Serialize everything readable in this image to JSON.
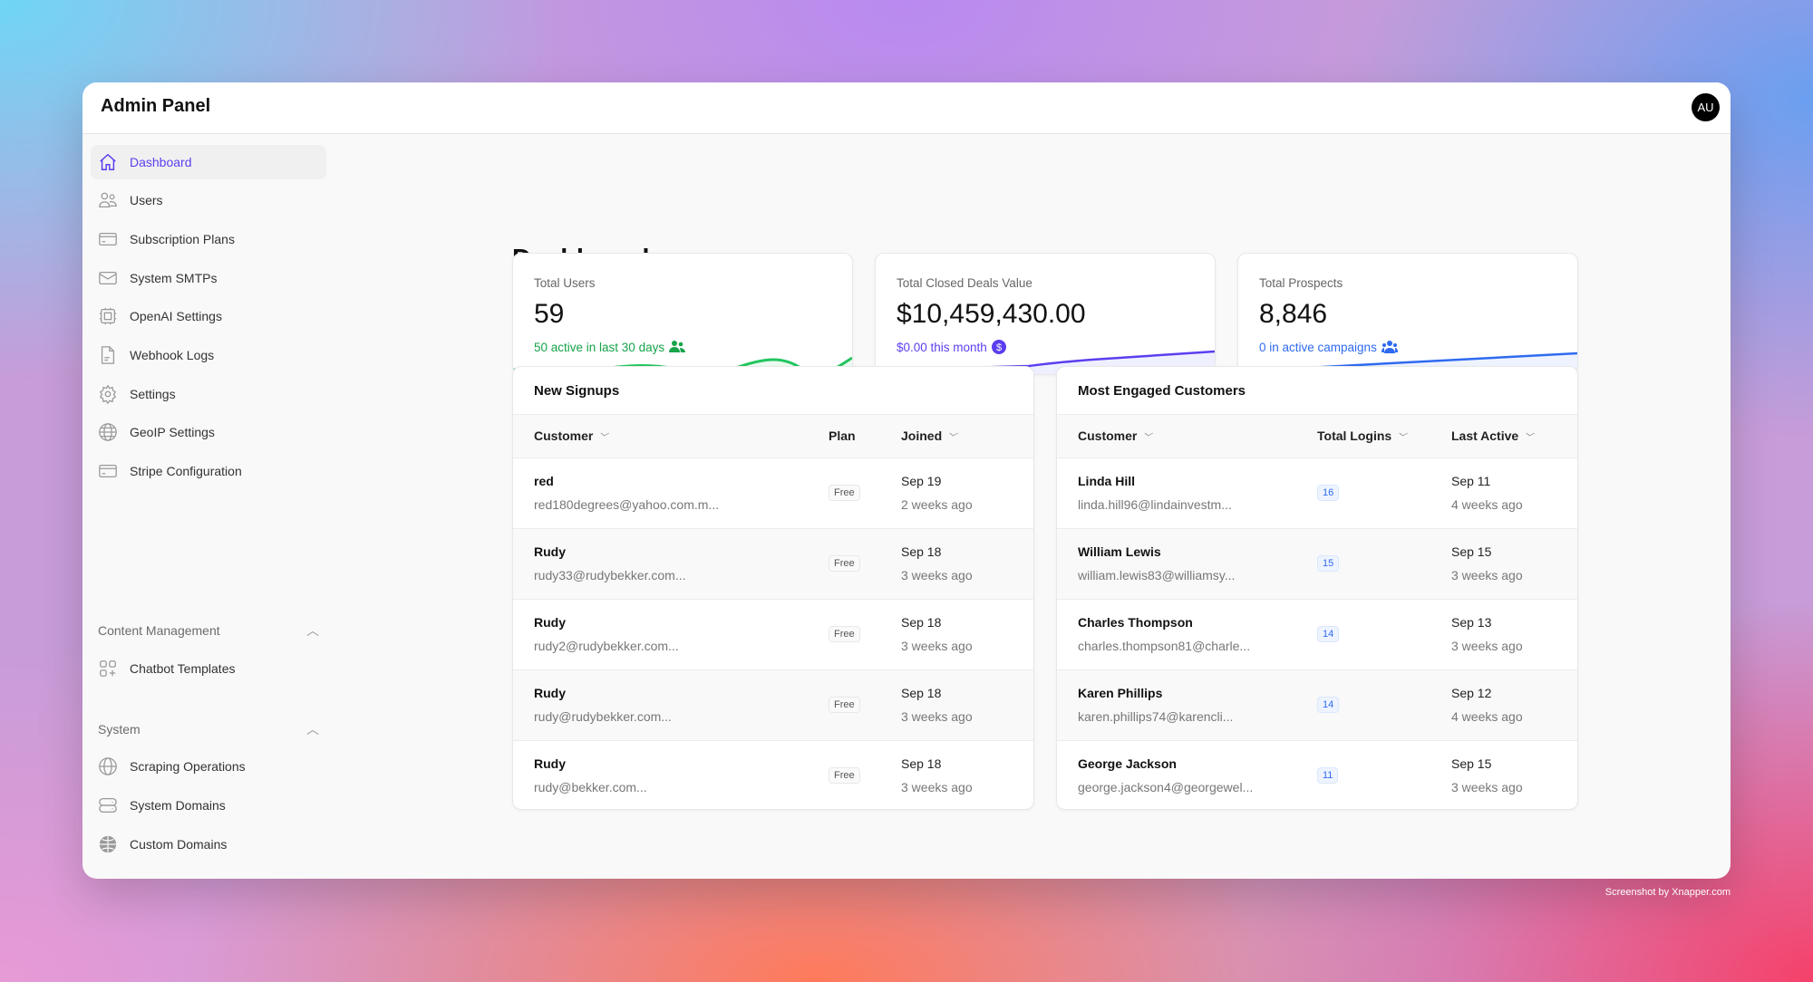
{
  "app": {
    "title": "Admin Panel",
    "avatar": "AU"
  },
  "sidebar": {
    "items": [
      {
        "label": "Dashboard",
        "icon": "home-icon",
        "active": true
      },
      {
        "label": "Users",
        "icon": "users-icon"
      },
      {
        "label": "Subscription Plans",
        "icon": "credit-card-icon"
      },
      {
        "label": "System SMTPs",
        "icon": "mail-icon"
      },
      {
        "label": "OpenAI Settings",
        "icon": "cpu-chip-icon"
      },
      {
        "label": "Webhook Logs",
        "icon": "document-icon"
      },
      {
        "label": "Settings",
        "icon": "gear-icon"
      },
      {
        "label": "GeoIP Settings",
        "icon": "globe-icon"
      },
      {
        "label": "Stripe Configuration",
        "icon": "credit-card-icon"
      }
    ],
    "sections": [
      {
        "label": "Content Management",
        "items": [
          {
            "label": "Chatbot Templates",
            "icon": "squares-plus-icon"
          }
        ]
      },
      {
        "label": "System",
        "items": [
          {
            "label": "Scraping Operations",
            "icon": "globe-icon"
          },
          {
            "label": "System Domains",
            "icon": "server-stack-icon"
          },
          {
            "label": "Custom Domains",
            "icon": "globe-filled-icon"
          }
        ]
      }
    ]
  },
  "main": {
    "title": "Dashboard",
    "cards": [
      {
        "label": "Total Users",
        "value": "59",
        "sub": "50 active in last 30 days",
        "color": "#16a34a"
      },
      {
        "label": "Total Closed Deals Value",
        "value": "$10,459,430.00",
        "sub": "$0.00 this month",
        "color": "#5b3ef0"
      },
      {
        "label": "Total Prospects",
        "value": "8,846",
        "sub": "0 in active campaigns",
        "color": "#2f6af0"
      }
    ],
    "signups": {
      "title": "New Signups",
      "columns": [
        "Customer",
        "Plan",
        "Joined"
      ],
      "rows": [
        {
          "name": "red",
          "email": "red180degrees@yahoo.com.m...",
          "plan": "Free",
          "date": "Sep 19",
          "ago": "2 weeks ago"
        },
        {
          "name": "Rudy",
          "email": "rudy33@rudybekker.com...",
          "plan": "Free",
          "date": "Sep 18",
          "ago": "3 weeks ago"
        },
        {
          "name": "Rudy",
          "email": "rudy2@rudybekker.com...",
          "plan": "Free",
          "date": "Sep 18",
          "ago": "3 weeks ago"
        },
        {
          "name": "Rudy",
          "email": "rudy@rudybekker.com...",
          "plan": "Free",
          "date": "Sep 18",
          "ago": "3 weeks ago"
        },
        {
          "name": "Rudy",
          "email": "rudy@bekker.com...",
          "plan": "Free",
          "date": "Sep 18",
          "ago": "3 weeks ago"
        }
      ]
    },
    "engaged": {
      "title": "Most Engaged Customers",
      "columns": [
        "Customer",
        "Total Logins",
        "Last Active"
      ],
      "rows": [
        {
          "name": "Linda Hill",
          "email": "linda.hill96@lindainvestm...",
          "logins": "16",
          "date": "Sep 11",
          "ago": "4 weeks ago"
        },
        {
          "name": "William Lewis",
          "email": "william.lewis83@williamsy...",
          "logins": "15",
          "date": "Sep 15",
          "ago": "3 weeks ago"
        },
        {
          "name": "Charles Thompson",
          "email": "charles.thompson81@charle...",
          "logins": "14",
          "date": "Sep 13",
          "ago": "3 weeks ago"
        },
        {
          "name": "Karen Phillips",
          "email": "karen.phillips74@karencli...",
          "logins": "14",
          "date": "Sep 12",
          "ago": "4 weeks ago"
        },
        {
          "name": "George Jackson",
          "email": "george.jackson4@georgewel...",
          "logins": "11",
          "date": "Sep 15",
          "ago": "3 weeks ago"
        }
      ]
    }
  },
  "footer": {
    "credit": "Screenshot by Xnapper.com"
  }
}
